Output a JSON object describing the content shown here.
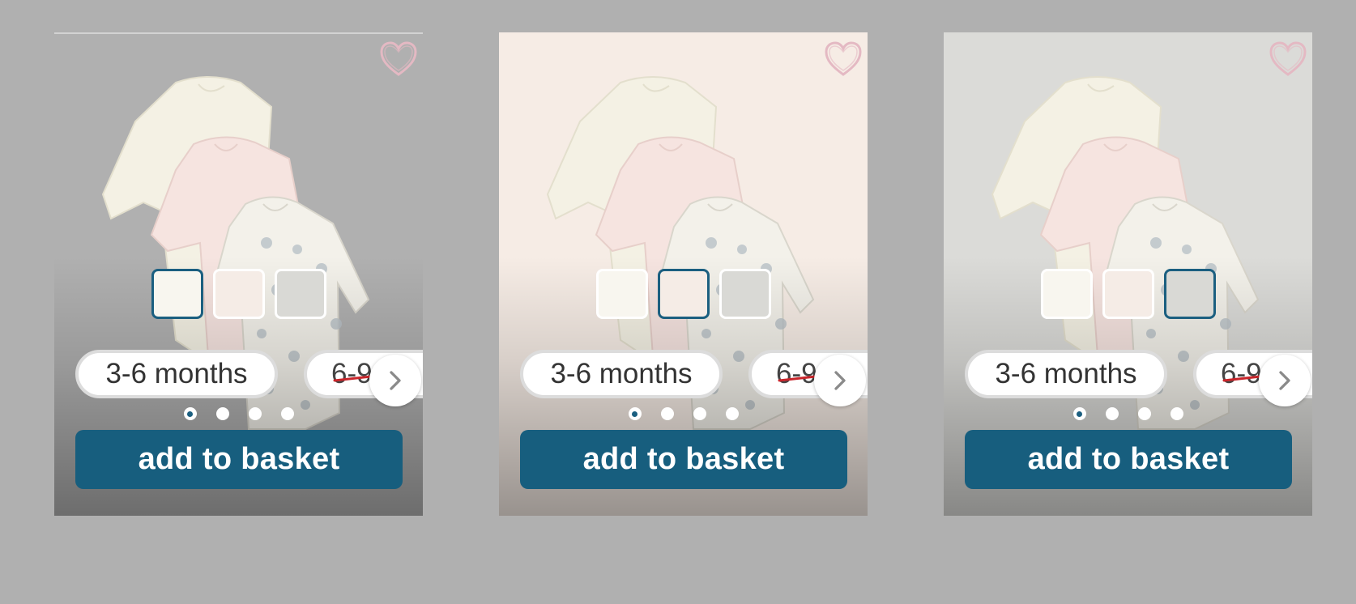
{
  "products": [
    {
      "background": "#b0b0b0",
      "wishlist_icon": "heart-outline-icon",
      "swatches": [
        {
          "color": "#f8f6ef",
          "selected": true
        },
        {
          "color": "#f5ece6",
          "selected": false
        },
        {
          "color": "#d9d9d5",
          "selected": false
        }
      ],
      "sizes": [
        {
          "label": "3-6 months"
        },
        {
          "label": "6-9"
        }
      ],
      "next_icon": "chevron-right-icon",
      "dots_total": 4,
      "dots_active": 1,
      "add_label": "add to basket"
    },
    {
      "background": "#f6ece5",
      "wishlist_icon": "heart-outline-icon",
      "swatches": [
        {
          "color": "#f8f6ef",
          "selected": false
        },
        {
          "color": "#f5ece6",
          "selected": true
        },
        {
          "color": "#d9d9d5",
          "selected": false
        }
      ],
      "sizes": [
        {
          "label": "3-6 months"
        },
        {
          "label": "6-9"
        }
      ],
      "next_icon": "chevron-right-icon",
      "dots_total": 4,
      "dots_active": 1,
      "add_label": "add to basket"
    },
    {
      "background": "#dbdbd8",
      "wishlist_icon": "heart-outline-icon",
      "swatches": [
        {
          "color": "#f8f6ef",
          "selected": false
        },
        {
          "color": "#f5ece6",
          "selected": false
        },
        {
          "color": "#d9d9d5",
          "selected": true
        }
      ],
      "sizes": [
        {
          "label": "3-6 months"
        },
        {
          "label": "6-9"
        }
      ],
      "next_icon": "chevron-right-icon",
      "dots_total": 4,
      "dots_active": 1,
      "add_label": "add to basket"
    }
  ],
  "colors": {
    "accent": "#175e7e",
    "heart_stroke": "#e4b9c3",
    "strike": "#c8252b"
  }
}
